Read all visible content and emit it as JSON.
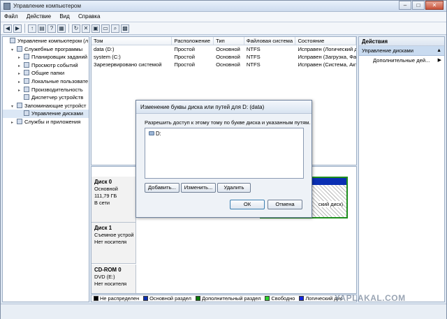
{
  "window": {
    "title": "Управление компьютером",
    "controls": [
      "–",
      "□",
      "✕"
    ]
  },
  "menu": [
    "Файл",
    "Действие",
    "Вид",
    "Справка"
  ],
  "toolbar_icons": [
    "back-icon",
    "forward-icon",
    "up-icon",
    "console-tree-icon",
    "help-icon",
    "properties-icon",
    "refresh-icon",
    "delete-icon",
    "export-icon",
    "folder-icon",
    "search-icon",
    "help2-icon"
  ],
  "tree": [
    {
      "label": "Управление компьютером (л",
      "indent": 0,
      "toggle": ""
    },
    {
      "label": "Служебные программы",
      "indent": 1,
      "toggle": "▾"
    },
    {
      "label": "Планировщик заданий",
      "indent": 2,
      "toggle": "▸"
    },
    {
      "label": "Просмотр событий",
      "indent": 2,
      "toggle": "▸"
    },
    {
      "label": "Общие папки",
      "indent": 2,
      "toggle": "▸"
    },
    {
      "label": "Локальные пользовате",
      "indent": 2,
      "toggle": "▸"
    },
    {
      "label": "Производительность",
      "indent": 2,
      "toggle": "▸"
    },
    {
      "label": "Диспетчер устройств",
      "indent": 2,
      "toggle": ""
    },
    {
      "label": "Запоминающие устройст",
      "indent": 1,
      "toggle": "▾"
    },
    {
      "label": "Управление дисками",
      "indent": 2,
      "toggle": "",
      "selected": true
    },
    {
      "label": "Службы и приложения",
      "indent": 1,
      "toggle": "▸"
    }
  ],
  "volume_list": {
    "headers": [
      "Том",
      "Расположение",
      "Тип",
      "Файловая система",
      "Состояние"
    ],
    "rows": [
      [
        "data (D:)",
        "Простой",
        "Основной",
        "NTFS",
        "Исправен (Логический ди"
      ],
      [
        "system (C:)",
        "Простой",
        "Основной",
        "NTFS",
        "Исправен (Загрузка, Фай"
      ],
      [
        "Зарезервировано системой",
        "Простой",
        "Основной",
        "NTFS",
        "Исправен (Система, Акти"
      ]
    ]
  },
  "disks": [
    {
      "name": "Диск 0",
      "lines": [
        "Основной",
        "111,79 ГБ",
        "В сети"
      ]
    },
    {
      "name": "Диск 1",
      "lines": [
        "Съемное устрой",
        "",
        "Нет носителя"
      ]
    },
    {
      "name": "CD-ROM 0",
      "lines": [
        "DVD (E:)",
        "",
        "Нет носителя"
      ]
    }
  ],
  "partition_visible_text": "ский диск)",
  "legend": [
    {
      "label": "Не распределен",
      "color": "#000000"
    },
    {
      "label": "Основной раздел",
      "color": "#0a2fb3"
    },
    {
      "label": "Дополнительный раздел",
      "color": "#0a7a0a"
    },
    {
      "label": "Свободно",
      "color": "#2fd32f"
    },
    {
      "label": "Логический дис",
      "color": "#1428e0"
    }
  ],
  "actions": {
    "header": "Действия",
    "section": "Управление дисками",
    "item": "Дополнительные дей..."
  },
  "dialog": {
    "title": "Изменение буквы диска или путей для D: (data)",
    "description": "Разрешить доступ к этому тому по букве диска и указанным путям.",
    "entries": [
      "D:"
    ],
    "add": "Добавить...",
    "change": "Изменить...",
    "remove": "Удалить",
    "ok": "ОК",
    "cancel": "Отмена"
  },
  "watermark": "YAPLAKAL.COM"
}
